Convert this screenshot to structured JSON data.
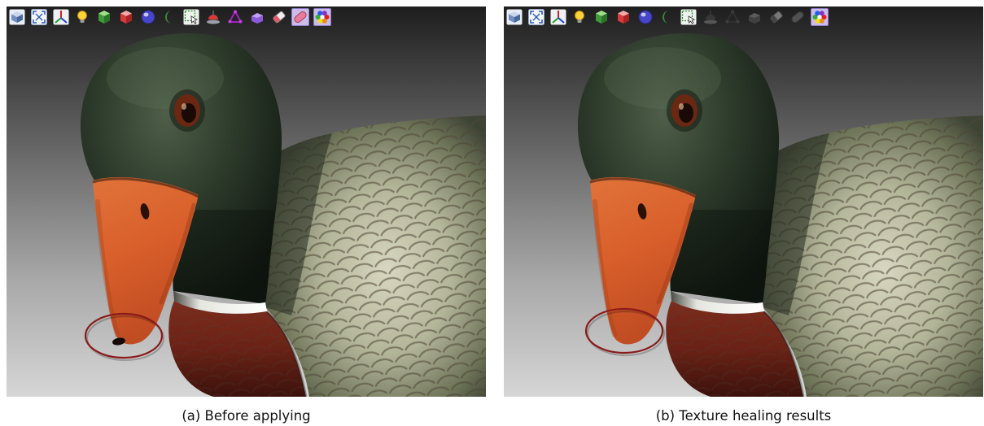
{
  "toolbar_icons": [
    "view-cube",
    "zoom-fit",
    "axes",
    "light-bulb",
    "green-cube",
    "red-cube",
    "sphere",
    "crescent",
    "select-region",
    "dome-pin",
    "triangle-node",
    "purple-block",
    "eraser",
    "pill",
    "rainbow-palette"
  ],
  "panels": [
    {
      "caption": "(a) Before applying",
      "defect_visible": true,
      "active_icons": [
        "pill",
        "rainbow-palette"
      ],
      "disabled_icons": []
    },
    {
      "caption": "(b) Texture healing results",
      "defect_visible": false,
      "active_icons": [
        "rainbow-palette"
      ],
      "disabled_icons": [
        "dome-pin",
        "triangle-node",
        "purple-block",
        "eraser",
        "pill"
      ]
    }
  ],
  "colors": {
    "annotation_ellipse": "#8b1a1a",
    "beak": "#d95f2b",
    "active_icon_bg": "#cbbcec"
  }
}
